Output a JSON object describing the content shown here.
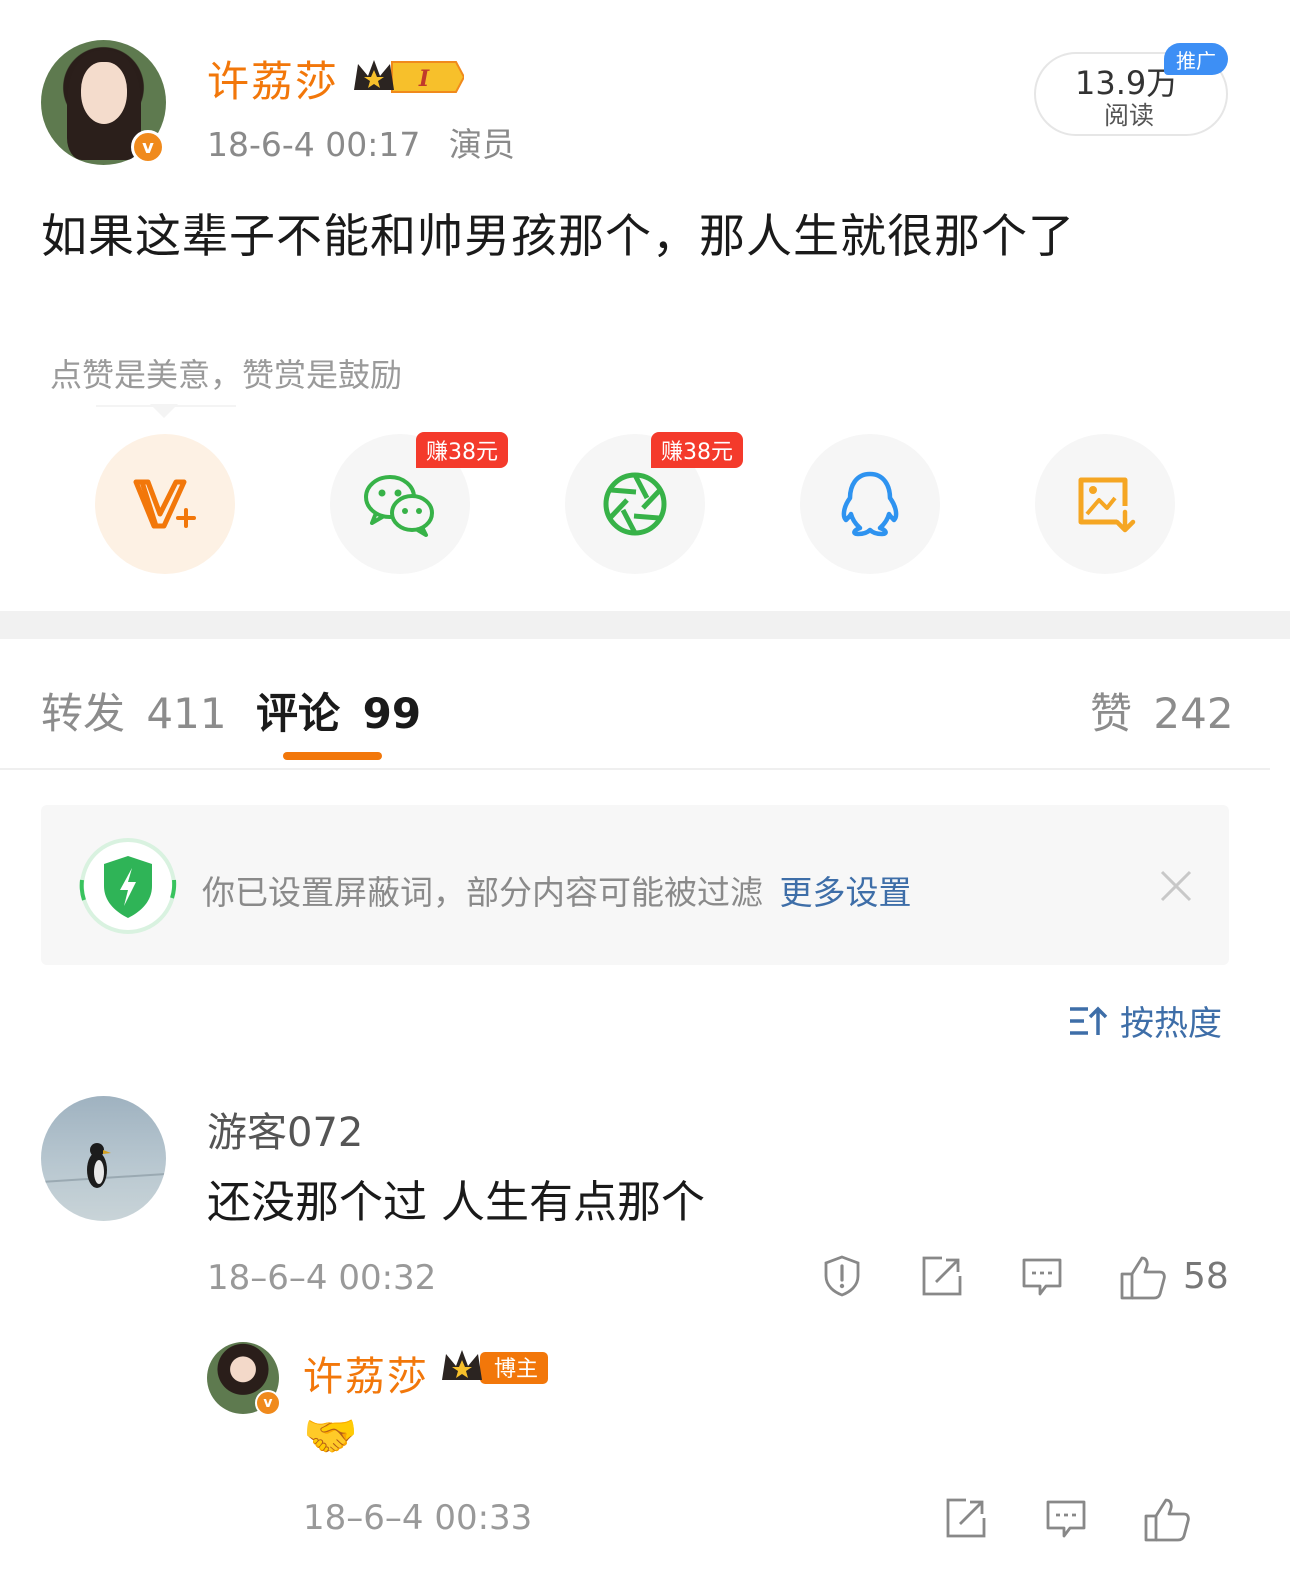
{
  "post": {
    "author": "许荔莎",
    "level_badge": "I",
    "time": "18-6-4 00:17",
    "role": "演员",
    "reads_value": "13.9万",
    "reads_label": "阅读",
    "promo_tag": "推广",
    "content": "如果这辈子不能和帅男孩那个，那人生就很那个了"
  },
  "reward_tip": "点赞是美意，赞赏是鼓励",
  "share": {
    "earn_tag": "赚38元",
    "items": [
      "reward",
      "wechat",
      "moments",
      "qq",
      "save-image"
    ]
  },
  "tabs": {
    "repost_label": "转发",
    "repost_count": "411",
    "comment_label": "评论",
    "comment_count": "99",
    "like_label": "赞",
    "like_count": "242"
  },
  "notice": {
    "text": "你已设置屏蔽词，部分内容可能被过滤",
    "link": "更多设置"
  },
  "sort": {
    "label": "按热度"
  },
  "comments": [
    {
      "user": "游客072",
      "text": "还没那个过 人生有点那个",
      "time": "18–6–4 00:32",
      "likes": "58",
      "reply": {
        "user": "许荔莎",
        "badge": "博主",
        "emoji": "🤝",
        "time": "18–6–4 00:33"
      }
    }
  ],
  "colors": {
    "brand_orange": "#f2770a",
    "link_blue": "#3e6ea8",
    "earn_red": "#f43a2b",
    "promo_blue": "#3d8ff5"
  }
}
